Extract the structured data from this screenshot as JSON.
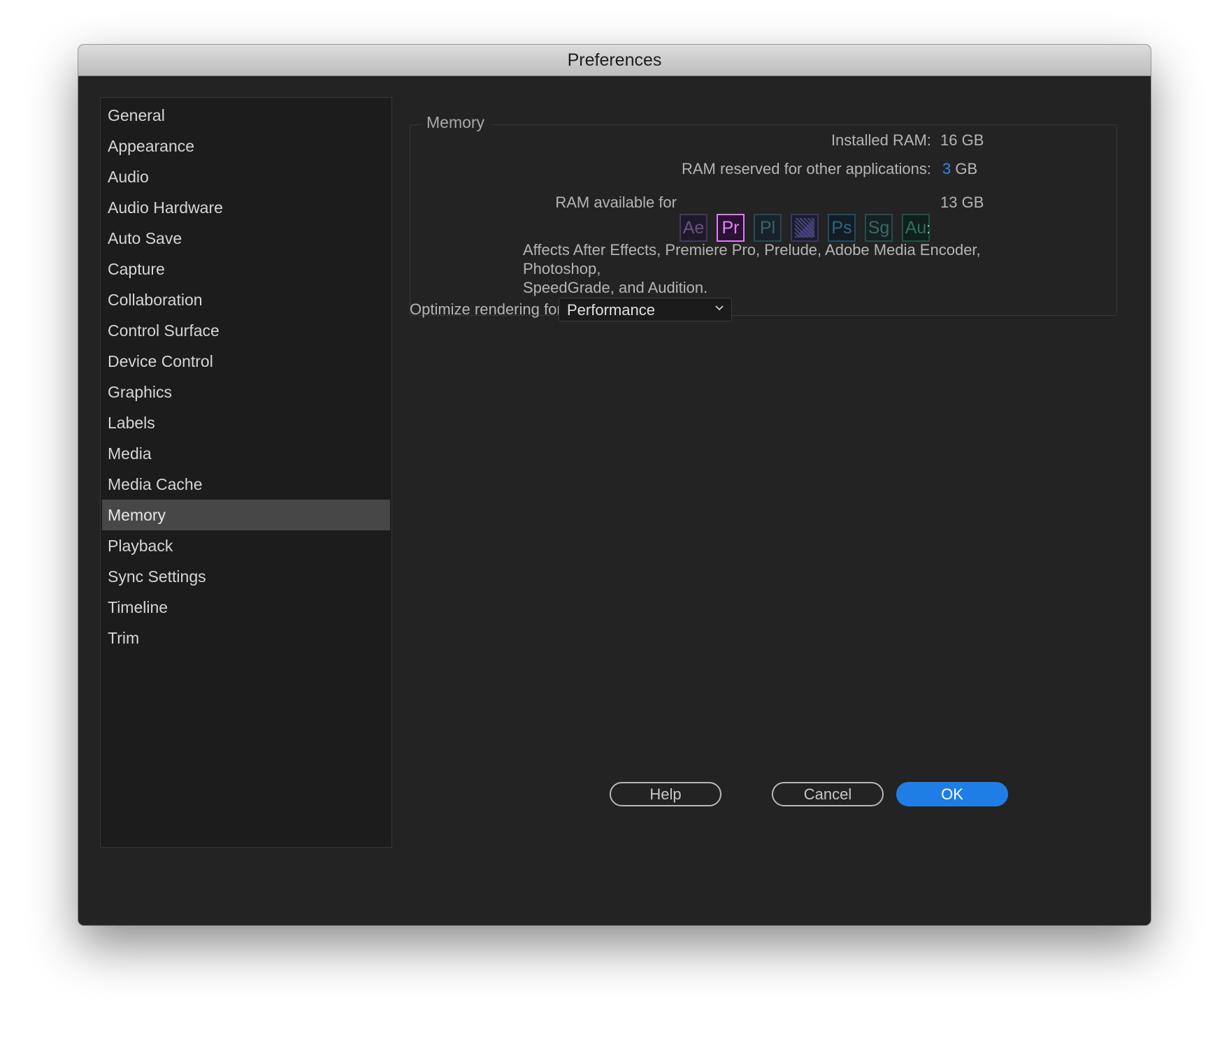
{
  "window": {
    "title": "Preferences"
  },
  "sidebar": {
    "items": [
      {
        "label": "General"
      },
      {
        "label": "Appearance"
      },
      {
        "label": "Audio"
      },
      {
        "label": "Audio Hardware"
      },
      {
        "label": "Auto Save"
      },
      {
        "label": "Capture"
      },
      {
        "label": "Collaboration"
      },
      {
        "label": "Control Surface"
      },
      {
        "label": "Device Control"
      },
      {
        "label": "Graphics"
      },
      {
        "label": "Labels"
      },
      {
        "label": "Media"
      },
      {
        "label": "Media Cache"
      },
      {
        "label": "Memory",
        "selected": true
      },
      {
        "label": "Playback"
      },
      {
        "label": "Sync Settings"
      },
      {
        "label": "Timeline"
      },
      {
        "label": "Trim"
      }
    ]
  },
  "memory": {
    "group_title": "Memory",
    "installed_label": "Installed RAM:",
    "installed_value": "16 GB",
    "reserved_label": "RAM reserved for other applications:",
    "reserved_value": "3",
    "reserved_unit": "GB",
    "available_label": "RAM available for",
    "available_value": "13 GB",
    "colon": ":",
    "apps": [
      {
        "abbr": "Ae",
        "icon": "after-effects-icon"
      },
      {
        "abbr": "Pr",
        "icon": "premiere-pro-icon"
      },
      {
        "abbr": "Pl",
        "icon": "prelude-icon"
      },
      {
        "abbr": "",
        "icon": "media-encoder-icon"
      },
      {
        "abbr": "Ps",
        "icon": "photoshop-icon"
      },
      {
        "abbr": "Sg",
        "icon": "speedgrade-icon"
      },
      {
        "abbr": "Au",
        "icon": "audition-icon"
      }
    ],
    "note_line1": "Affects After Effects, Premiere Pro, Prelude, Adobe Media Encoder, Photoshop,",
    "note_line2": "SpeedGrade, and Audition."
  },
  "optimize": {
    "label": "Optimize rendering for:",
    "value": "Performance"
  },
  "buttons": {
    "help": "Help",
    "cancel": "Cancel",
    "ok": "OK"
  },
  "colors": {
    "accent": "#2d8ceb",
    "primary_button": "#1f7ee6",
    "premiere": "#e279ff"
  }
}
